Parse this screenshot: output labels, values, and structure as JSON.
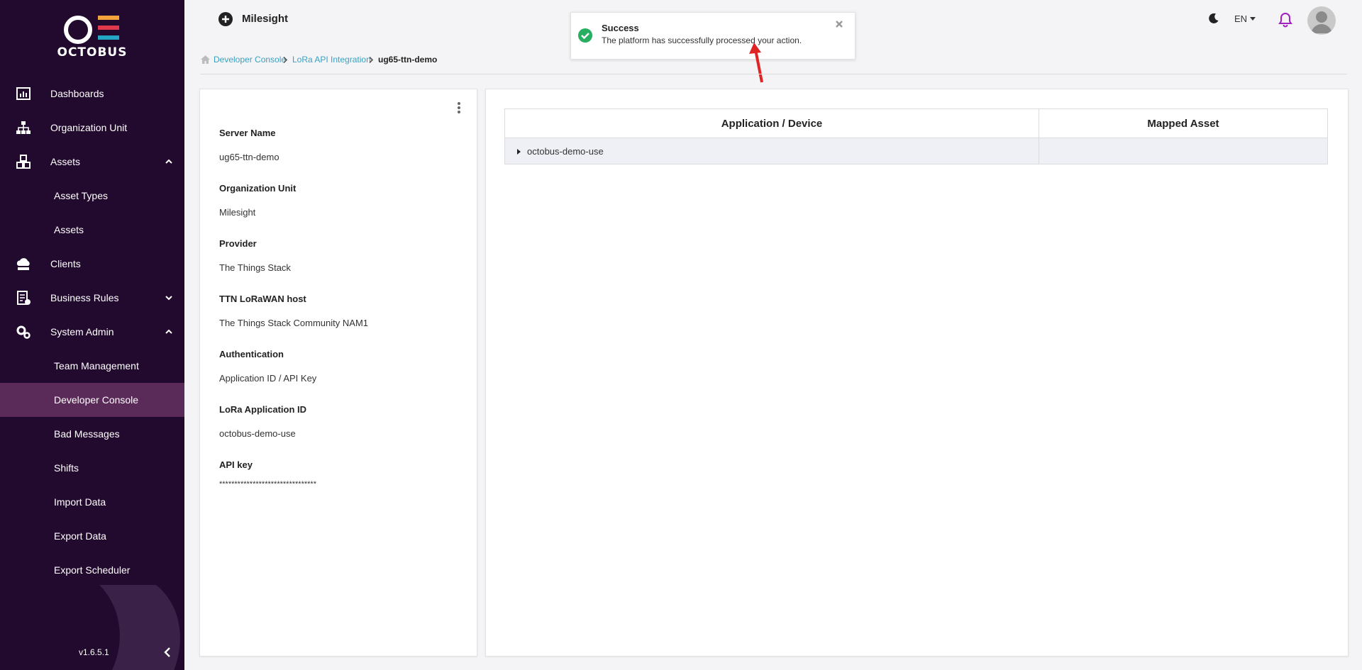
{
  "app": {
    "brand": "OCTOBUS",
    "version": "v1.6.5.1"
  },
  "sidebar": {
    "items": [
      {
        "label": "Dashboards"
      },
      {
        "label": "Organization Unit"
      },
      {
        "label": "Assets"
      },
      {
        "label": "Asset Types"
      },
      {
        "label": "Assets"
      },
      {
        "label": "Clients"
      },
      {
        "label": "Business Rules"
      },
      {
        "label": "System Admin"
      },
      {
        "label": "Team Management"
      },
      {
        "label": "Developer Console"
      },
      {
        "label": "Bad Messages"
      },
      {
        "label": "Shifts"
      },
      {
        "label": "Import Data"
      },
      {
        "label": "Export Data"
      },
      {
        "label": "Export Scheduler"
      }
    ]
  },
  "topbar": {
    "org_name": "Milesight",
    "language": "EN"
  },
  "toast": {
    "title": "Success",
    "message": "The platform has successfully processed your action."
  },
  "breadcrumb": {
    "items": [
      "Developer Console",
      "LoRa API Integration"
    ],
    "current": "ug65-ttn-demo"
  },
  "details": {
    "fields": [
      {
        "label": "Server Name",
        "value": "ug65-ttn-demo"
      },
      {
        "label": "Organization Unit",
        "value": "Milesight"
      },
      {
        "label": "Provider",
        "value": "The Things Stack"
      },
      {
        "label": "TTN LoRaWAN host",
        "value": "The Things Stack Community NAM1"
      },
      {
        "label": "Authentication",
        "value": "Application ID / API Key"
      },
      {
        "label": "LoRa Application ID",
        "value": "octobus-demo-use"
      },
      {
        "label": "API key",
        "value": "********************************"
      }
    ]
  },
  "mapping_table": {
    "headers": [
      "Application / Device",
      "Mapped Asset"
    ],
    "rows": [
      {
        "application": "octobus-demo-use",
        "mapped_asset": ""
      }
    ]
  },
  "colors": {
    "sidebar_bg": "#22092e",
    "sidebar_active": "#5a2a58",
    "link": "#3aa0c0",
    "success": "#27ae60",
    "bell": "#a020c0"
  }
}
